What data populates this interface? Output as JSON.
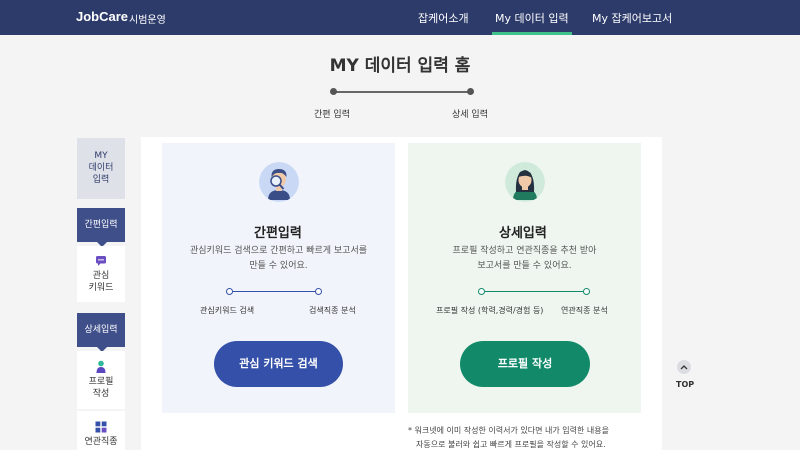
{
  "header": {
    "brand": "JobCare",
    "brand_sub": "시범운영",
    "nav": [
      "잡케어소개",
      "My 데이터 입력",
      "My 잡케어보고서"
    ],
    "active_index": 1,
    "accent_color": "#3fc28a",
    "bg_color": "#2d3b6b"
  },
  "page": {
    "title": "MY 데이터 입력 홈",
    "steps": [
      "간편 입력",
      "상세 입력"
    ]
  },
  "sidebar": {
    "home": [
      "MY",
      "데이터",
      "입력"
    ],
    "quick_section": "간편입력",
    "quick_item": [
      "관심",
      "키워드"
    ],
    "detail_section": "상세입력",
    "detail_item": [
      "프로필",
      "작성"
    ],
    "extra_item": "연관직종"
  },
  "cards": {
    "quick": {
      "title": "간편입력",
      "desc1": "관심키워드 검색으로 간편하고 빠르게 보고서를",
      "desc2": "만들 수 있어요.",
      "step1": "관심키워드 검색",
      "step2": "검색직종 분석",
      "button": "관심 키워드 검색",
      "icon": "magnifier-person-icon"
    },
    "detail": {
      "title": "상세입력",
      "desc1": "프로필 작성하고 연관직종을 추천 받아",
      "desc2": "보고서를 만들 수 있어요.",
      "step1": "프로필 작성 (학력,경력/경험 등)",
      "step2": "연관직종 분석",
      "button": "프로필 작성",
      "icon": "woman-avatar-icon"
    }
  },
  "note": {
    "line1": "* 워크넷에 이미 작성한 이력서가 있다면 내가 입력한 내용을",
    "line2": "자동으로 불러와 쉽고 빠르게 프로필을 작성할 수 있어요."
  },
  "top": {
    "label": "TOP",
    "icon": "chevron-up-icon"
  }
}
